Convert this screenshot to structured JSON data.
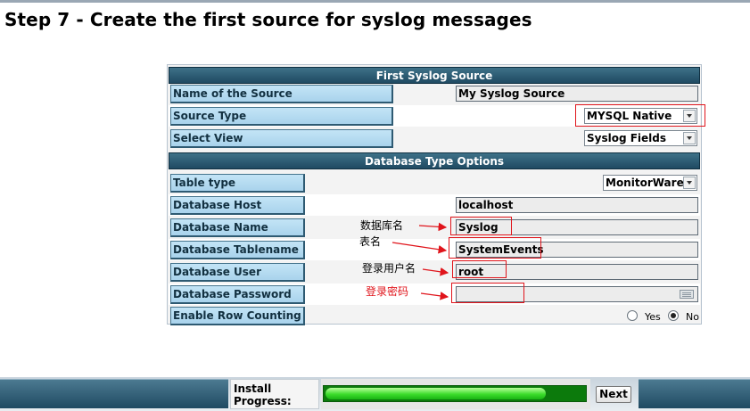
{
  "page": {
    "title": "Step 7 - Create the first source for syslog messages"
  },
  "form": {
    "section1_header": "First Syslog Source",
    "source_name_label": "Name of the Source",
    "source_name_value": "My Syslog Source",
    "source_type_label": "Source Type",
    "source_type_value": "MYSQL Native",
    "select_view_label": "Select View",
    "select_view_value": "Syslog Fields",
    "section2_header": "Database Type Options",
    "table_type_label": "Table type",
    "table_type_value": "MonitorWare",
    "db_host_label": "Database Host",
    "db_host_value": "localhost",
    "db_name_label": "Database Name",
    "db_name_value": "Syslog",
    "db_tablename_label": "Database Tablename",
    "db_tablename_value": "SystemEvents",
    "db_user_label": "Database User",
    "db_user_value": "root",
    "db_password_label": "Database Password",
    "db_password_value": "",
    "row_counting_label": "Enable Row Counting",
    "row_counting_yes": "Yes",
    "row_counting_no": "No",
    "row_counting_selected": "No"
  },
  "annotations": {
    "db_name_note": "数据库名",
    "table_name_note": "表名",
    "user_note": "登录用户名",
    "password_note": "登录密码",
    "highlight_color": "#e0141b"
  },
  "footer": {
    "install_label_1": "Install",
    "install_label_2": "Progress:",
    "progress_fraction": 0.85,
    "next_label": "Next"
  }
}
